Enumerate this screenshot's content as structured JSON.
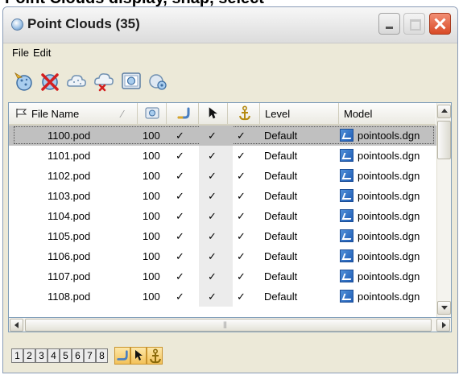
{
  "window": {
    "title": "Point Clouds (35)"
  },
  "menu": {
    "file": "File",
    "edit": "Edit"
  },
  "toolbar": {
    "icons": [
      "attach-point-cloud-icon",
      "detach-point-cloud-icon",
      "cloud-icon",
      "cloud-remove-icon",
      "display-view-icon",
      "cloud-settings-icon"
    ]
  },
  "columns": {
    "file_name": "File Name",
    "display": "display-icon",
    "class": "classification-icon",
    "select": "select-arrow-icon",
    "snap": "snap-anchor-icon",
    "level": "Level",
    "model": "Model"
  },
  "rows": [
    {
      "file": "1100.pod",
      "pct": "100",
      "c1": "✓",
      "c2": "✓",
      "c3": "✓",
      "level": "Default",
      "model": "pointools.dgn",
      "selected": true
    },
    {
      "file": "1101.pod",
      "pct": "100",
      "c1": "✓",
      "c2": "✓",
      "c3": "✓",
      "level": "Default",
      "model": "pointools.dgn"
    },
    {
      "file": "1102.pod",
      "pct": "100",
      "c1": "✓",
      "c2": "✓",
      "c3": "✓",
      "level": "Default",
      "model": "pointools.dgn"
    },
    {
      "file": "1103.pod",
      "pct": "100",
      "c1": "✓",
      "c2": "✓",
      "c3": "✓",
      "level": "Default",
      "model": "pointools.dgn"
    },
    {
      "file": "1104.pod",
      "pct": "100",
      "c1": "✓",
      "c2": "✓",
      "c3": "✓",
      "level": "Default",
      "model": "pointools.dgn"
    },
    {
      "file": "1105.pod",
      "pct": "100",
      "c1": "✓",
      "c2": "✓",
      "c3": "✓",
      "level": "Default",
      "model": "pointools.dgn"
    },
    {
      "file": "1106.pod",
      "pct": "100",
      "c1": "✓",
      "c2": "✓",
      "c3": "✓",
      "level": "Default",
      "model": "pointools.dgn"
    },
    {
      "file": "1107.pod",
      "pct": "100",
      "c1": "✓",
      "c2": "✓",
      "c3": "✓",
      "level": "Default",
      "model": "pointools.dgn"
    },
    {
      "file": "1108.pod",
      "pct": "100",
      "c1": "✓",
      "c2": "✓",
      "c3": "✓",
      "level": "Default",
      "model": "pointools.dgn"
    }
  ],
  "bottom": {
    "numbers": [
      "1",
      "2",
      "3",
      "4",
      "5",
      "6",
      "7",
      "8"
    ],
    "toggles": [
      "classification-icon",
      "select-arrow-icon",
      "snap-anchor-icon"
    ]
  },
  "colors": {
    "selected_row": "#c0c0c0",
    "model_icon": "#2f6fc6",
    "toggle_active": "#f3c25a"
  }
}
